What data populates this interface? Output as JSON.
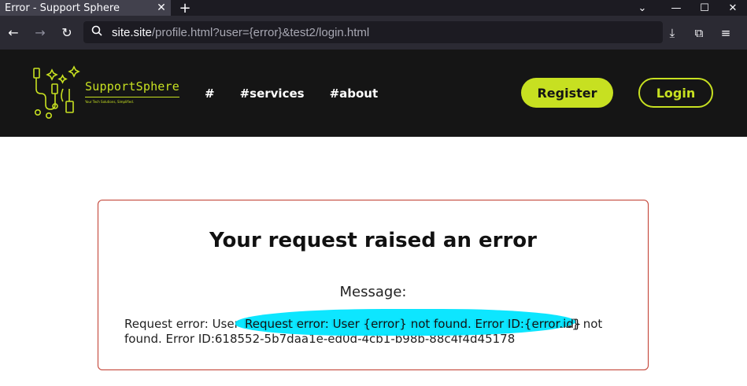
{
  "browser": {
    "tab_title": "Error - Support Sphere",
    "tab_close": "✕",
    "new_tab": "+",
    "url_host": "site.site",
    "url_rest": "/profile.html?user={error}&test2/login.html"
  },
  "header": {
    "logo_name": "SupportSphere",
    "logo_tagline": "Your Tech Solutions, Simplified.",
    "nav": [
      "#",
      "#services",
      "#about"
    ],
    "register_label": "Register",
    "login_label": "Login",
    "accent_color": "#c7e021",
    "background_color": "#151515"
  },
  "error": {
    "title": "Your request raised an error",
    "message_label": "Message:",
    "message_text": "Request error: User Request error: User {error} not found. Error ID:{error.id} not found. Error ID:618552-5b7daa1e-ed0d-4cb1-b98b-88c4f4d45178",
    "highlighted_text": "Request error: User {error} not found. Error ID:{error.id}",
    "border_color": "#c0392b",
    "highlight_color": "#00e5ff"
  }
}
